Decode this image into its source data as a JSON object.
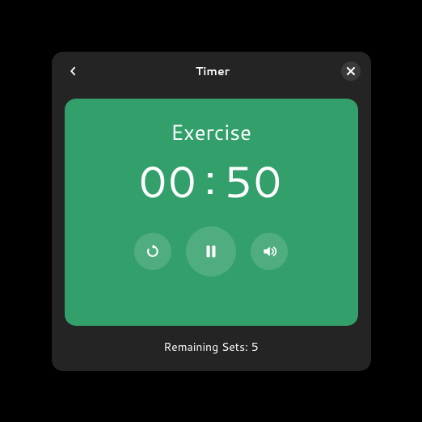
{
  "header": {
    "title": "Timer"
  },
  "timer": {
    "phase_label": "Exercise",
    "time_minutes": "00",
    "time_seconds": "50"
  },
  "footer": {
    "remaining_label": "Remaining Sets: 5"
  },
  "colors": {
    "accent": "#33a06b",
    "window_bg": "#242424"
  }
}
